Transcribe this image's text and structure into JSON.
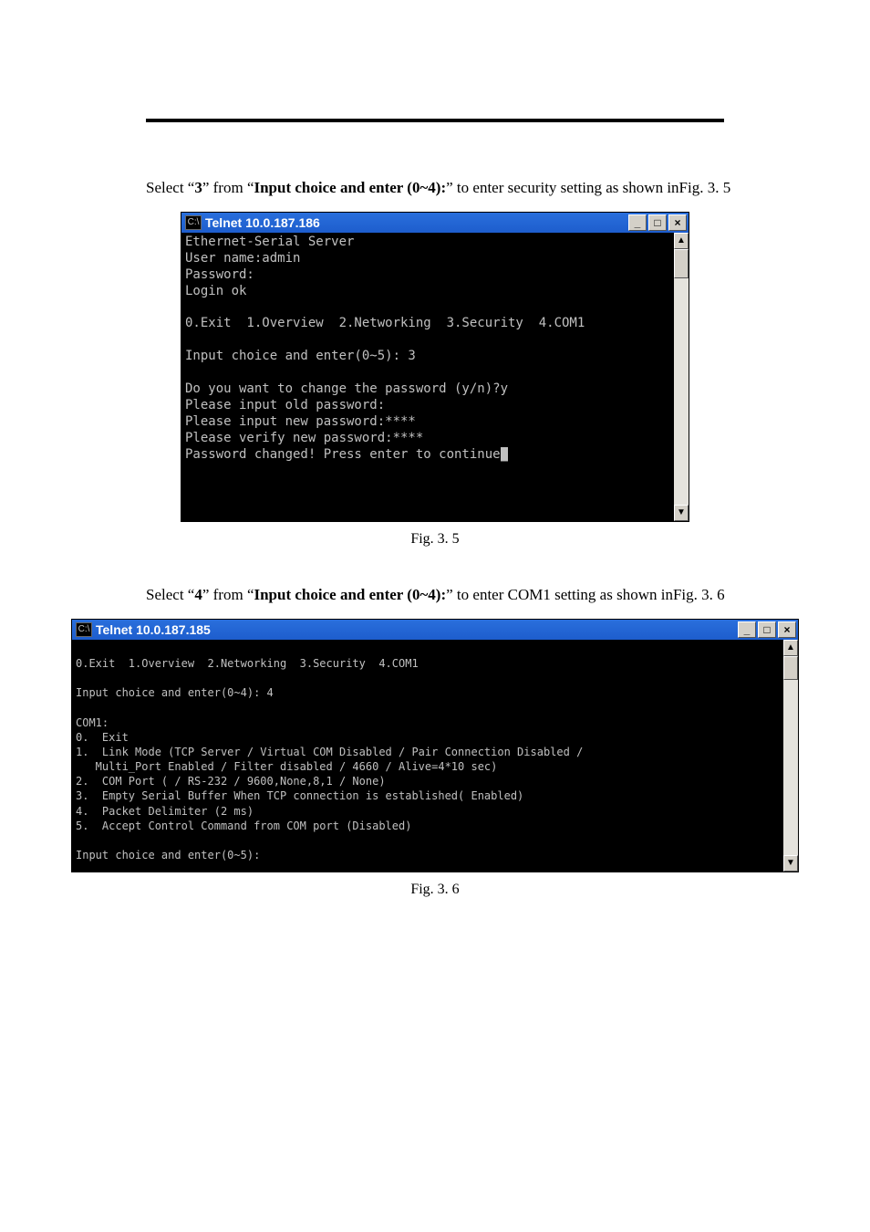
{
  "para1": {
    "pre": "Select ",
    "q1o": "“",
    "bold1": "3",
    "q1c": "”",
    "mid": " from ",
    "q2o": "“",
    "prompt": "Input choice and enter (0~4):",
    "q2c": "”",
    "tail": " to enter security setting as shown in ",
    "fig": "Fig. 3. 5"
  },
  "window1": {
    "title": "Telnet 10.0.187.186",
    "icon": "C:\\",
    "lines": [
      "Ethernet-Serial Server",
      "User name:admin",
      "Password:",
      "Login ok",
      "",
      "0.Exit  1.Overview  2.Networking  3.Security  4.COM1",
      "",
      "Input choice and enter(0~5): 3",
      "",
      "Do you want to change the password (y/n)?y",
      "Please input old password:",
      "Please input new password:****",
      "Please verify new password:****",
      "Password changed! Press enter to continue"
    ]
  },
  "buttons": {
    "min": "_",
    "max": "□",
    "close": "×"
  },
  "arrows": {
    "up": "▲",
    "down": "▼"
  },
  "caption1": "Fig. 3. 5",
  "para2": {
    "pre": "Select ",
    "q1o": "“",
    "bold1": "4",
    "q1c": "”",
    "mid": " from ",
    "q2o": "“",
    "prompt": "Input choice and enter (0~4):",
    "q2c": "”",
    "tail": " to enter COM1 setting as shown in ",
    "fig": "Fig. 3. 6"
  },
  "window2": {
    "title": "Telnet 10.0.187.185",
    "icon": "C:\\",
    "lines": [
      "",
      "0.Exit  1.Overview  2.Networking  3.Security  4.COM1",
      "",
      "Input choice and enter(0~4): 4",
      "",
      "COM1:",
      "0.  Exit",
      "1.  Link Mode (TCP Server / Virtual COM Disabled / Pair Connection Disabled /",
      "   Multi_Port Enabled / Filter disabled / 4660 / Alive=4*10 sec)",
      "2.  COM Port ( / RS-232 / 9600,None,8,1 / None)",
      "3.  Empty Serial Buffer When TCP connection is established( Enabled)",
      "4.  Packet Delimiter (2 ms)",
      "5.  Accept Control Command from COM port (Disabled)",
      "",
      "Input choice and enter(0~5):"
    ]
  },
  "caption2": "Fig. 3. 6"
}
